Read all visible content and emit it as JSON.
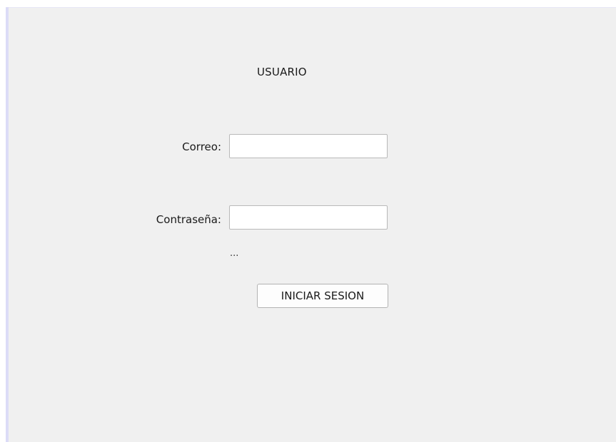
{
  "form": {
    "title": "USUARIO",
    "email_label": "Correo:",
    "email_value": "",
    "password_label": "Contraseña:",
    "password_value": "",
    "hint_text": "...",
    "login_button_label": "INICIAR SESION"
  },
  "colors": {
    "background": "#f0f0f0",
    "field_background": "#ffffff",
    "field_border": "#b9b9b9",
    "accent_border": "#dcdcf7"
  }
}
